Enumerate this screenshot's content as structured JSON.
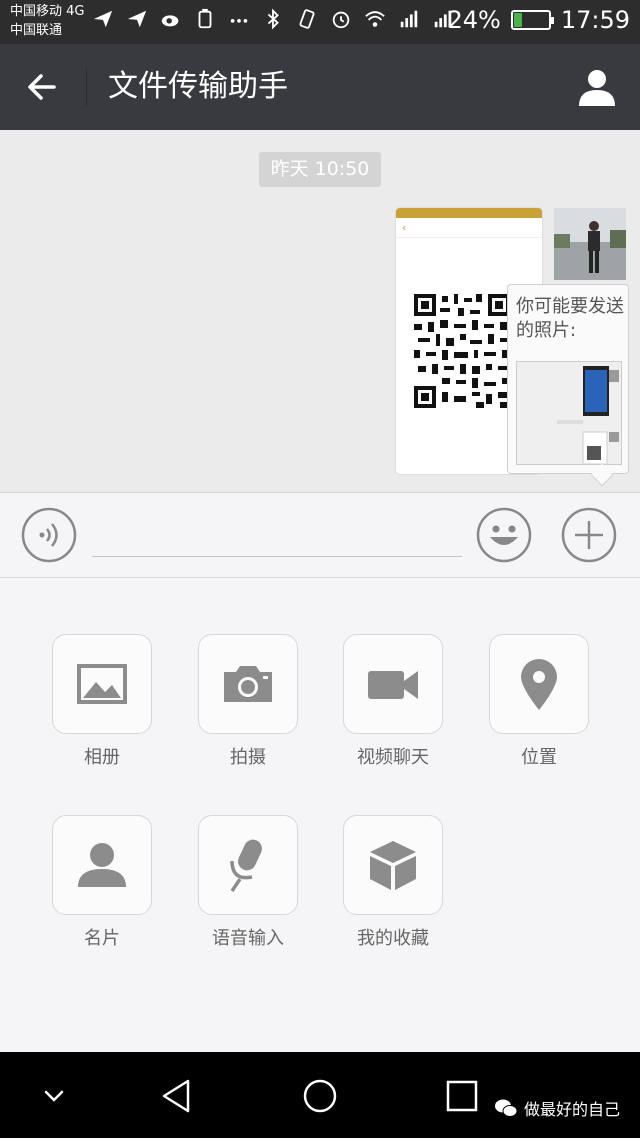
{
  "status_bar": {
    "carrier1": "中国移动 4G",
    "carrier2": "中国联通",
    "battery": "24%",
    "battery_level": 0.24,
    "time": "17:59"
  },
  "title_bar": {
    "title": "文件传输助手"
  },
  "chat": {
    "timestamp": "昨天 10:50",
    "suggest_text": "你可能要发送的照片:"
  },
  "input": {
    "value": "",
    "placeholder": ""
  },
  "panel": {
    "items": [
      {
        "label": "相册",
        "icon": "album-icon"
      },
      {
        "label": "拍摄",
        "icon": "camera-icon"
      },
      {
        "label": "视频聊天",
        "icon": "video-icon"
      },
      {
        "label": "位置",
        "icon": "location-icon"
      },
      {
        "label": "名片",
        "icon": "contact-card-icon"
      },
      {
        "label": "语音输入",
        "icon": "microphone-icon"
      },
      {
        "label": "我的收藏",
        "icon": "favorites-box-icon"
      }
    ]
  },
  "watermark": {
    "text": "做最好的自己"
  },
  "colors": {
    "status_bg": "#2d2d2e",
    "titlebar_bg": "#393a3f",
    "chat_bg": "#ebebeb",
    "panel_bg": "#f5f5f7",
    "icon_gray": "#8c8c8c"
  }
}
